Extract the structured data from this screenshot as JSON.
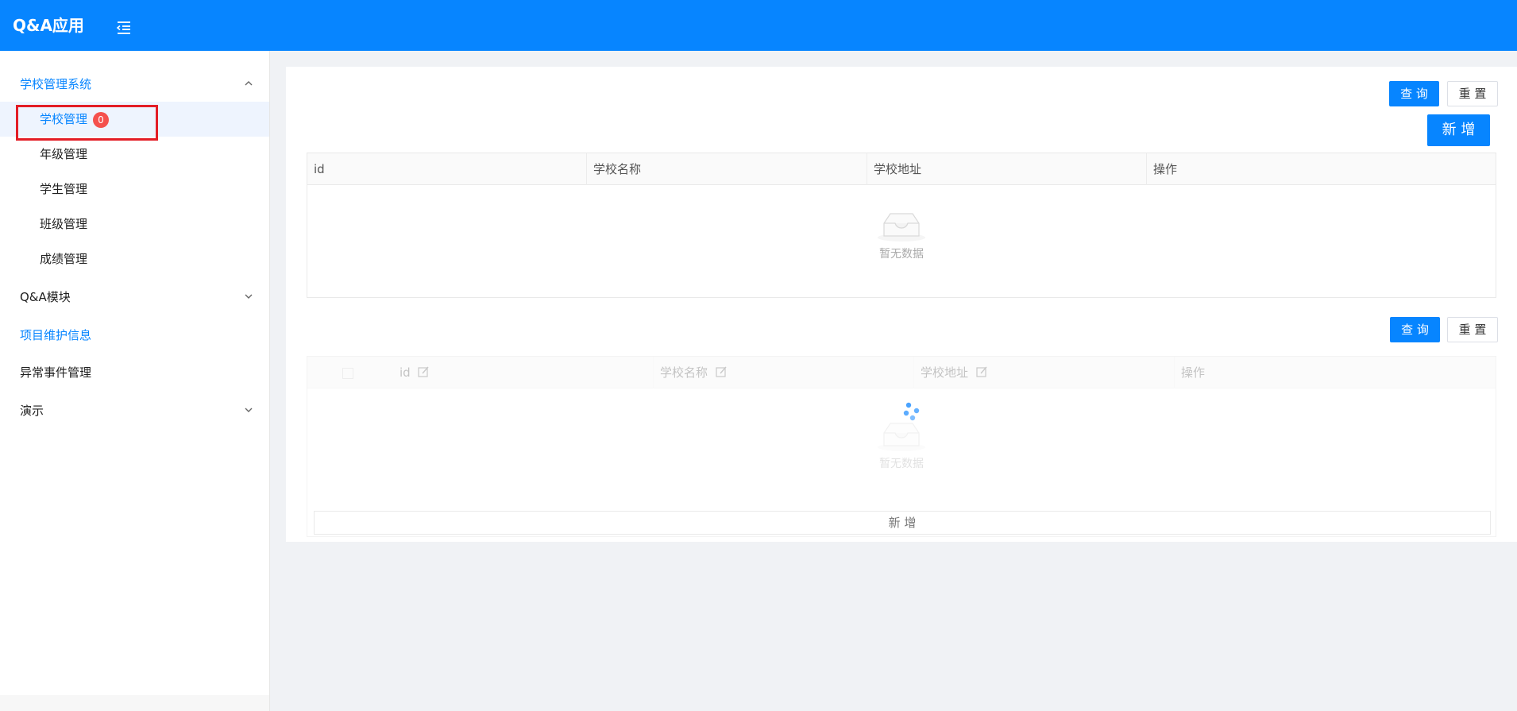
{
  "app": {
    "title": "Q&A应用"
  },
  "sidebar": {
    "groups": [
      {
        "label": "学校管理系统",
        "expanded": true
      },
      {
        "label": "Q&A模块",
        "expanded": false
      },
      {
        "label": "项目维护信息"
      },
      {
        "label": "异常事件管理"
      },
      {
        "label": "演示",
        "expanded": false
      }
    ],
    "sub_items": [
      {
        "label": "学校管理",
        "badge": "0",
        "selected": true
      },
      {
        "label": "年级管理"
      },
      {
        "label": "学生管理"
      },
      {
        "label": "班级管理"
      },
      {
        "label": "成绩管理"
      }
    ]
  },
  "panel1": {
    "query_label": "查 询",
    "reset_label": "重 置",
    "add_label": "新 增",
    "columns": [
      "id",
      "学校名称",
      "学校地址",
      "操作"
    ],
    "empty_text": "暂无数据"
  },
  "panel2": {
    "query_label": "查 询",
    "reset_label": "重 置",
    "columns": [
      "id",
      "学校名称",
      "学校地址",
      "操作"
    ],
    "empty_text": "暂无数据",
    "add_row_label": "新 增"
  },
  "colors": {
    "primary": "#0785ff",
    "badge": "#f5514d",
    "highlight": "#e31d26"
  }
}
